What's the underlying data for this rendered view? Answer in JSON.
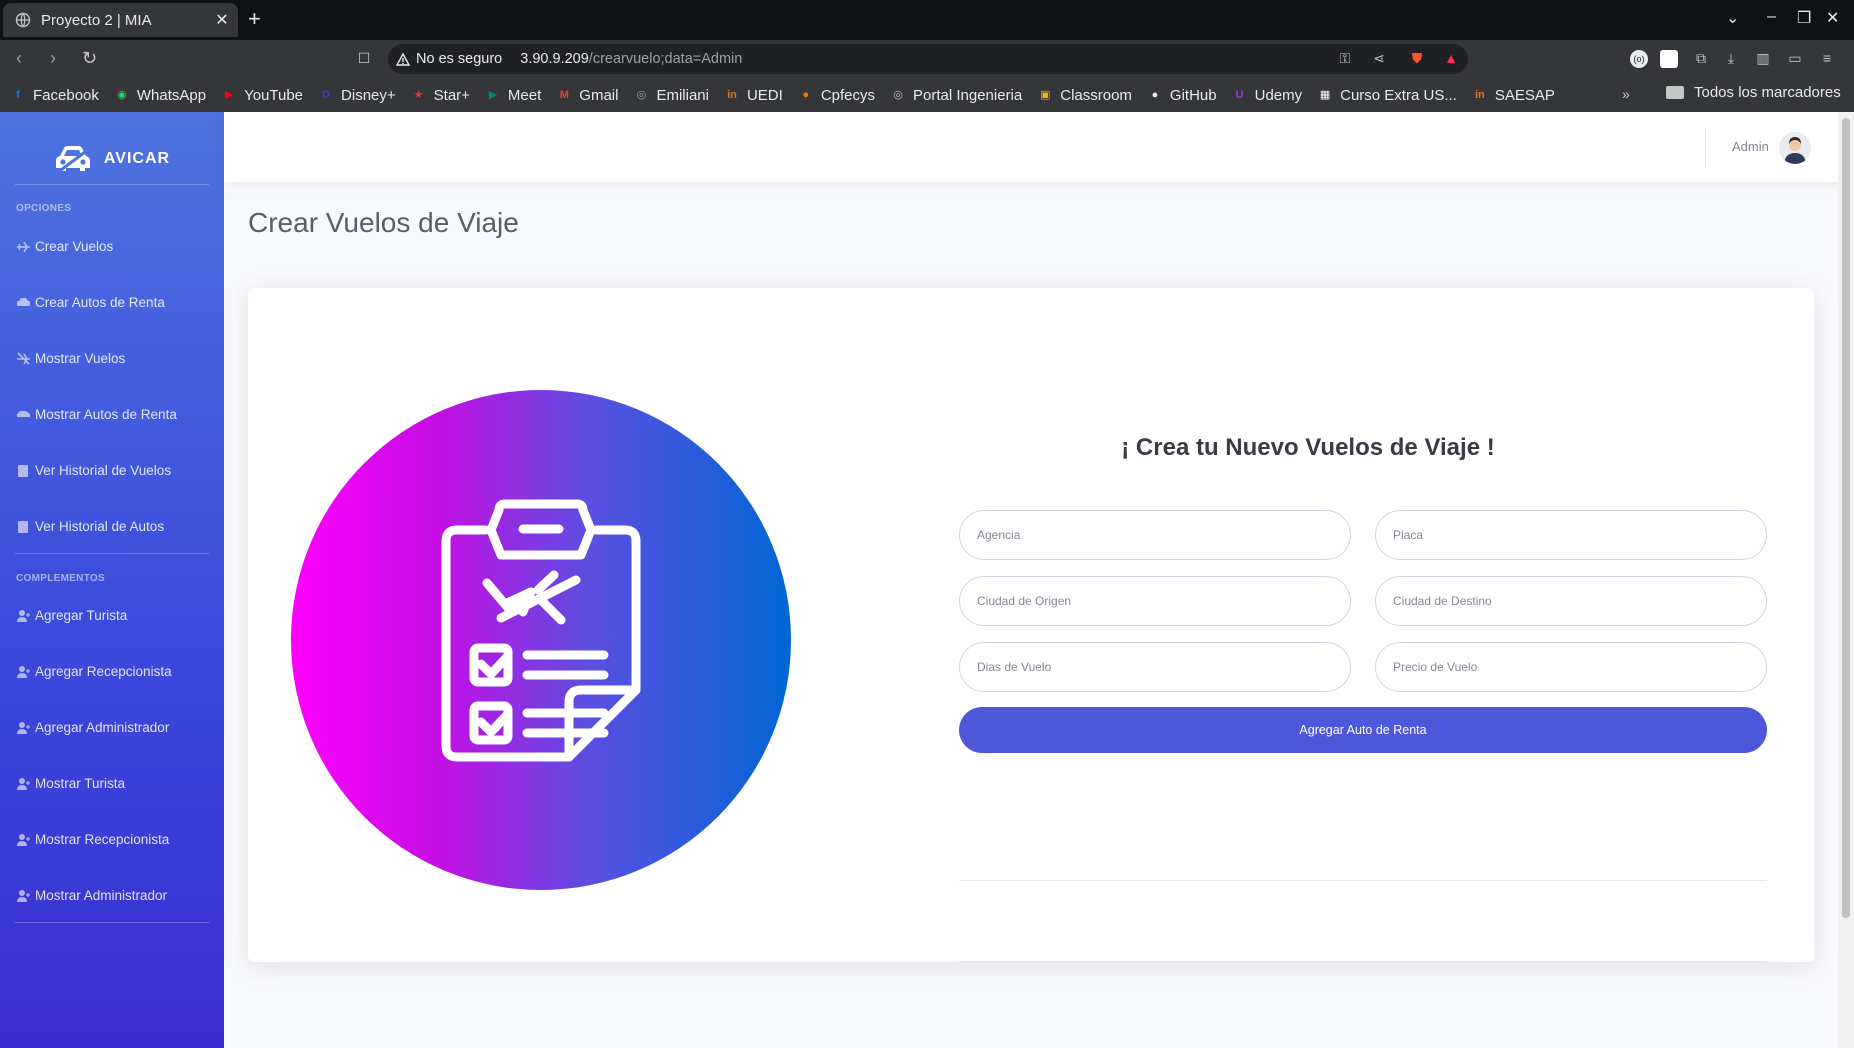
{
  "browser": {
    "tab_title": "Proyecto 2 | MIA",
    "tab_close": "✕",
    "new_tab": "+",
    "security_warning": "No es seguro",
    "url_host": "3.90.9.209",
    "url_path": "/crearvuelo;data=Admin",
    "bookmarks": [
      {
        "label": "Facebook",
        "icon": "facebook-icon",
        "color": "#1877f2"
      },
      {
        "label": "WhatsApp",
        "icon": "whatsapp-icon",
        "color": "#25d366"
      },
      {
        "label": "YouTube",
        "icon": "youtube-icon",
        "color": "#ff0000"
      },
      {
        "label": "Disney+",
        "icon": "disney-icon",
        "color": "#3a3bd6"
      },
      {
        "label": "Star+",
        "icon": "star-icon",
        "color": "#e53935"
      },
      {
        "label": "Meet",
        "icon": "meet-icon",
        "color": "#00897b"
      },
      {
        "label": "Gmail",
        "icon": "gmail-icon",
        "color": "#ea4335"
      },
      {
        "label": "Emiliani",
        "icon": "globe-icon",
        "color": "#9aa0a6"
      },
      {
        "label": "UEDI",
        "icon": "uedi-icon",
        "color": "#e8711c"
      },
      {
        "label": "Cpfecys",
        "icon": "cpfecys-icon",
        "color": "#f57c00"
      },
      {
        "label": "Portal Ingenieria",
        "icon": "portal-icon",
        "color": "#bdbdbd"
      },
      {
        "label": "Classroom",
        "icon": "classroom-icon",
        "color": "#f4b400"
      },
      {
        "label": "GitHub",
        "icon": "github-icon",
        "color": "#e8eaed"
      },
      {
        "label": "Udemy",
        "icon": "udemy-icon",
        "color": "#a435f0"
      },
      {
        "label": "Curso Extra US...",
        "icon": "curso-icon",
        "color": "#ffffff"
      },
      {
        "label": "SAESAP",
        "icon": "saesap-icon",
        "color": "#e8711c"
      }
    ],
    "all_bookmarks": "Todos los marcadores",
    "more_bookmarks": "»"
  },
  "sidebar": {
    "brand": "AVICAR",
    "heading_options": "OPCIONES",
    "heading_complements": "COMPLEMENTOS",
    "options": [
      {
        "label": "Crear Vuelos",
        "icon": "plane-icon"
      },
      {
        "label": "Crear Autos de Renta",
        "icon": "car-icon"
      },
      {
        "label": "Mostrar Vuelos",
        "icon": "plane-slash-icon"
      },
      {
        "label": "Mostrar Autos de Renta",
        "icon": "car-side-icon"
      },
      {
        "label": "Ver Historial de Vuelos",
        "icon": "book-icon"
      },
      {
        "label": "Ver Historial de Autos",
        "icon": "book-icon"
      }
    ],
    "complements": [
      {
        "label": "Agregar Turista",
        "icon": "user-plus-icon"
      },
      {
        "label": "Agregar Recepcionista",
        "icon": "user-plus-icon"
      },
      {
        "label": "Agregar Administrador",
        "icon": "user-plus-icon"
      },
      {
        "label": "Mostrar Turista",
        "icon": "user-plus-icon"
      },
      {
        "label": "Mostrar Recepcionista",
        "icon": "user-plus-icon"
      },
      {
        "label": "Mostrar Administrador",
        "icon": "user-plus-icon"
      }
    ]
  },
  "topbar": {
    "user_name": "Admin"
  },
  "page": {
    "title": "Crear Vuelos de Viaje"
  },
  "form": {
    "title": "¡ Crea tu Nuevo Vuelos de Viaje !",
    "fields": {
      "agencia": {
        "placeholder": "Agencia",
        "value": ""
      },
      "placa": {
        "placeholder": "Placa",
        "value": ""
      },
      "origen": {
        "placeholder": "Ciudad de Origen",
        "value": ""
      },
      "destino": {
        "placeholder": "Ciudad de Destino",
        "value": ""
      },
      "dias": {
        "placeholder": "Dias de Vuelo",
        "value": ""
      },
      "precio": {
        "placeholder": "Precio de Vuelo",
        "value": ""
      }
    },
    "submit_label": "Agregar Auto de Renta"
  },
  "colors": {
    "sidebar_top": "#4e73df",
    "sidebar_bottom": "#3a2ed0",
    "primary_button": "#4e56d9",
    "hero_gradient": [
      "#ff00ff",
      "#c30fe3",
      "#5a4fe0",
      "#0066d6"
    ]
  }
}
